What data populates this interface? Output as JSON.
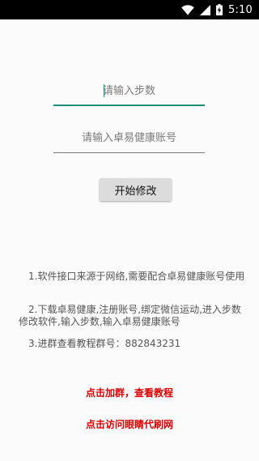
{
  "status_bar": {
    "time": "5:10",
    "icons": [
      "wifi-icon",
      "signal-icon",
      "battery-charging-icon"
    ]
  },
  "form": {
    "steps_placeholder": "请输入步数",
    "steps_value": "",
    "account_placeholder": "请输入卓易健康账号",
    "account_value": "",
    "start_button_label": "开始修改"
  },
  "info": {
    "line1": "1.软件接口来源于网络,需要配合卓易健康账号使用",
    "line2": "2.下载卓易健康,注册账号,绑定微信运动,进入步数修改软件,输入步数,输入卓易健康账号",
    "line3": "3.进群查看教程群号：882843231"
  },
  "links": {
    "join_group": "点击加群，查看教程",
    "visit_site": "点击访问眼睛代刷网"
  },
  "colors": {
    "accent": "#1a8f76",
    "link_red": "#e00000"
  }
}
